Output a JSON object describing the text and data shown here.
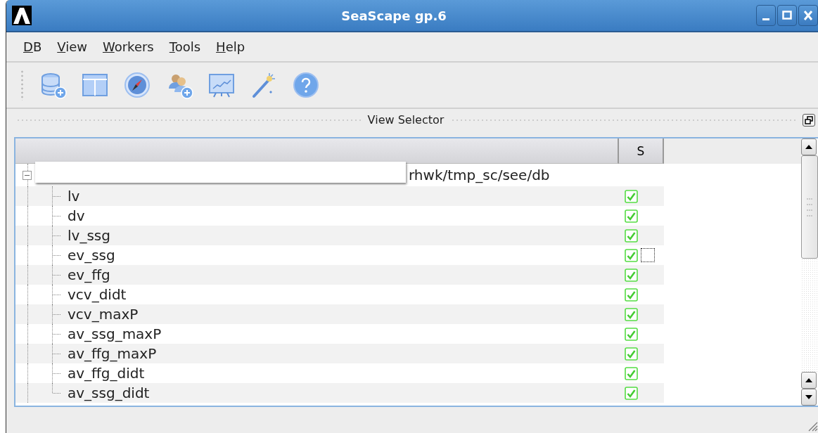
{
  "window": {
    "title": "SeaScape gp.6"
  },
  "menu": [
    "DB",
    "View",
    "Workers",
    "Tools",
    "Help"
  ],
  "panel": {
    "title": "View Selector"
  },
  "tree": {
    "header": {
      "column_2": "S"
    },
    "nodes": [
      {
        "label": "rhwk/tmp_sc/see/db",
        "expanded": true,
        "children": [
          {
            "label": "lv",
            "checked": true,
            "focused": false
          },
          {
            "label": "dv",
            "checked": true,
            "focused": false
          },
          {
            "label": "lv_ssg",
            "checked": true,
            "focused": false
          },
          {
            "label": "ev_ssg",
            "checked": true,
            "focused": true
          },
          {
            "label": "ev_ffg",
            "checked": true,
            "focused": false
          },
          {
            "label": "vcv_didt",
            "checked": true,
            "focused": false
          },
          {
            "label": "vcv_maxP",
            "checked": true,
            "focused": false
          },
          {
            "label": "av_ssg_maxP",
            "checked": true,
            "focused": false
          },
          {
            "label": "av_ffg_maxP",
            "checked": true,
            "focused": false
          },
          {
            "label": "av_ffg_didt",
            "checked": true,
            "focused": false
          },
          {
            "label": "av_ssg_didt",
            "checked": true,
            "focused": false
          }
        ]
      }
    ]
  }
}
